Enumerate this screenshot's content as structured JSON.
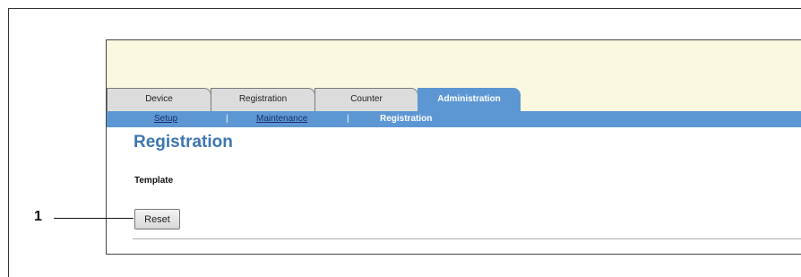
{
  "tabs": [
    {
      "label": "Device",
      "active": false
    },
    {
      "label": "Registration",
      "active": false
    },
    {
      "label": "Counter",
      "active": false
    },
    {
      "label": "Administration",
      "active": true
    }
  ],
  "subnav": {
    "items": [
      "Setup",
      "Maintenance",
      "Registration"
    ],
    "separator": "|",
    "current_index": 2
  },
  "page": {
    "title": "Registration",
    "section_label": "Template",
    "reset_label": "Reset"
  },
  "callout": {
    "number": "1"
  },
  "colors": {
    "accent_blue": "#5d97d3",
    "title_blue": "#3d76b0",
    "header_band": "#fbf8e0",
    "inactive_tab": "#dcdcdc"
  }
}
